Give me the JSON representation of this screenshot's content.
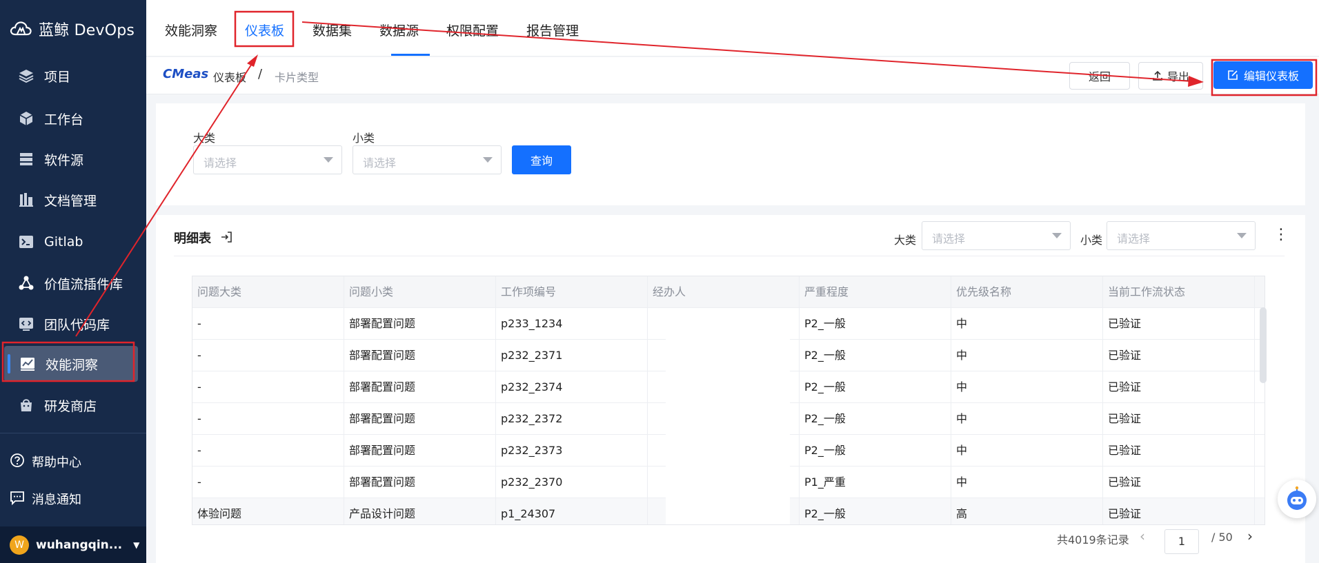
{
  "brand": {
    "name": "蓝鲸 DevOps"
  },
  "sidebar": {
    "items": [
      {
        "label": "项目",
        "icon": "layers-icon"
      },
      {
        "label": "工作台",
        "icon": "cube-icon"
      },
      {
        "label": "软件源",
        "icon": "storage-icon"
      },
      {
        "label": "文档管理",
        "icon": "docs-icon"
      },
      {
        "label": "Gitlab",
        "icon": "terminal-icon"
      },
      {
        "label": "价值流插件库",
        "icon": "plugin-icon"
      },
      {
        "label": "团队代码库",
        "icon": "code-icon"
      },
      {
        "label": "效能洞察",
        "icon": "chart-icon",
        "active": true
      },
      {
        "label": "研发商店",
        "icon": "store-icon"
      }
    ],
    "help": {
      "label": "帮助中心",
      "icon": "help-icon"
    },
    "notify": {
      "label": "消息通知",
      "icon": "message-icon"
    },
    "user": {
      "initial": "W",
      "name": "wuhangqin..."
    }
  },
  "tabs": [
    "效能洞察",
    "仪表板",
    "数据集",
    "数据源",
    "权限配置",
    "报告管理"
  ],
  "active_tab": "仪表板",
  "breadcrumb": {
    "logo": "CMeas",
    "root": "仪表板",
    "separator": "/",
    "current": "卡片类型"
  },
  "actions": {
    "back": "返回",
    "export": "导出",
    "edit": "编辑仪表板"
  },
  "filters": {
    "major_label": "大类",
    "minor_label": "小类",
    "placeholder": "请选择",
    "query": "查询"
  },
  "detail": {
    "title": "明细表",
    "major_label": "大类",
    "minor_label": "小类",
    "placeholder": "请选择",
    "columns": [
      "问题大类",
      "问题小类",
      "工作项编号",
      "经办人",
      "严重程度",
      "优先级名称",
      "当前工作流状态"
    ],
    "rows": [
      [
        "-",
        "部署配置问题",
        "p233_1234",
        "",
        "P2_一般",
        "中",
        "已验证"
      ],
      [
        "-",
        "部署配置问题",
        "p232_2371",
        "",
        "P2_一般",
        "中",
        "已验证"
      ],
      [
        "-",
        "部署配置问题",
        "p232_2374",
        "",
        "P2_一般",
        "中",
        "已验证"
      ],
      [
        "-",
        "部署配置问题",
        "p232_2372",
        "",
        "P2_一般",
        "中",
        "已验证"
      ],
      [
        "-",
        "部署配置问题",
        "p232_2373",
        "",
        "P2_一般",
        "中",
        "已验证"
      ],
      [
        "-",
        "部署配置问题",
        "p232_2370",
        "",
        "P1_严重",
        "中",
        "已验证"
      ],
      [
        "体验问题",
        "产品设计问题",
        "p1_24307",
        "",
        "P2_一般",
        "高",
        "已验证"
      ]
    ],
    "pagination": {
      "total": "共4019条记录",
      "current": "1",
      "pages": "/ 50"
    }
  }
}
